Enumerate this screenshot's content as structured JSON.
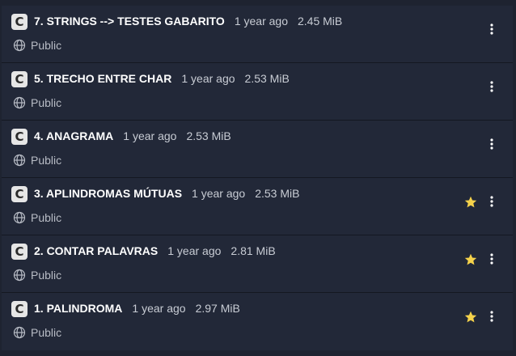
{
  "items": [
    {
      "title": "7. STRINGS --> TESTES GABARITO",
      "time": "1 year ago",
      "size": "2.45 MiB",
      "visibility": "Public",
      "starred": false,
      "app_letter": "C"
    },
    {
      "title": "5. TRECHO ENTRE CHAR",
      "time": "1 year ago",
      "size": "2.53 MiB",
      "visibility": "Public",
      "starred": false,
      "app_letter": "C"
    },
    {
      "title": "4. ANAGRAMA",
      "time": "1 year ago",
      "size": "2.53 MiB",
      "visibility": "Public",
      "starred": false,
      "app_letter": "C"
    },
    {
      "title": "3. APLINDROMAS MÚTUAS",
      "time": "1 year ago",
      "size": "2.53 MiB",
      "visibility": "Public",
      "starred": true,
      "app_letter": "C"
    },
    {
      "title": "2. CONTAR PALAVRAS",
      "time": "1 year ago",
      "size": "2.81 MiB",
      "visibility": "Public",
      "starred": true,
      "app_letter": "C"
    },
    {
      "title": "1. PALINDROMA",
      "time": "1 year ago",
      "size": "2.97 MiB",
      "visibility": "Public",
      "starred": true,
      "app_letter": "C"
    }
  ],
  "icons": {
    "app": "c-app-icon",
    "visibility": "globe-icon",
    "favorite": "star-icon",
    "menu": "more-vertical-icon"
  },
  "colors": {
    "background": "#1e2330",
    "row": "#222838",
    "star": "#f5d24b",
    "title": "#ffffff",
    "meta": "#c8ccd4"
  }
}
